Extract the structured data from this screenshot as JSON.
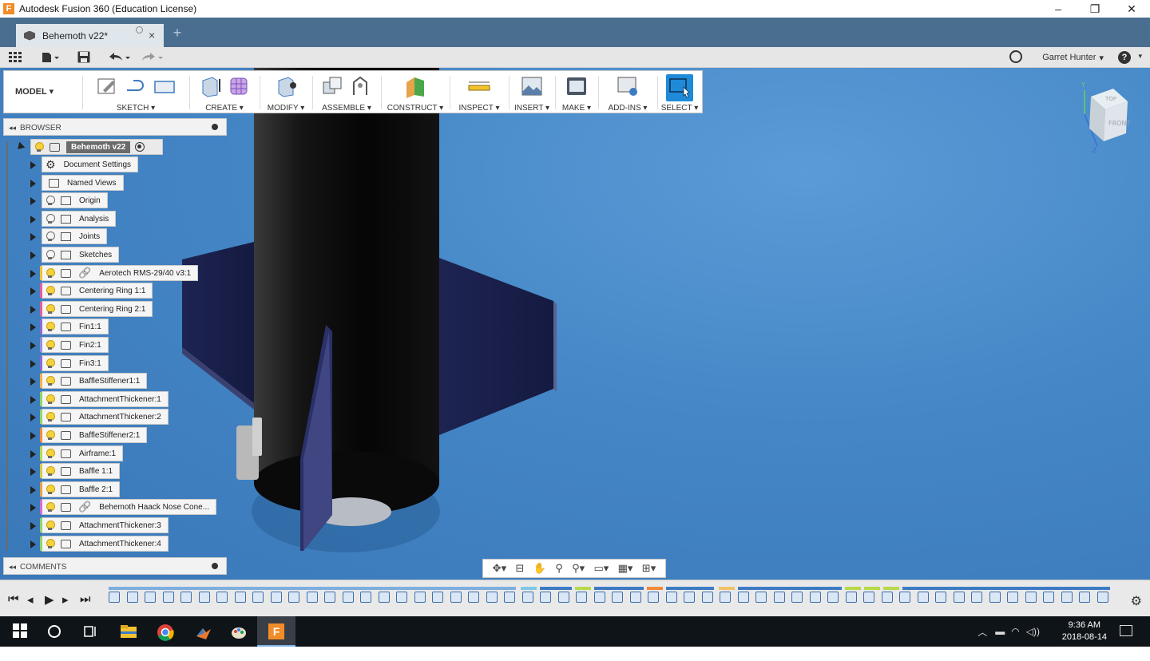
{
  "window": {
    "title": "Autodesk Fusion 360 (Education License)",
    "app_icon_letter": "F",
    "controls": [
      "–",
      "❐",
      "✕"
    ]
  },
  "tabs": {
    "document_tab": "Behemoth v22*",
    "new_tab_glyph": "+"
  },
  "quick_access": {
    "user": "Garret Hunter",
    "user_dropdown": "▾",
    "help_label": "?"
  },
  "toolbar": {
    "workspace": "MODEL ▾",
    "groups": [
      {
        "label": "SKETCH ▾"
      },
      {
        "label": "CREATE ▾"
      },
      {
        "label": "MODIFY ▾"
      },
      {
        "label": "ASSEMBLE ▾"
      },
      {
        "label": "CONSTRUCT ▾"
      },
      {
        "label": "INSPECT ▾"
      },
      {
        "label": "INSERT ▾"
      },
      {
        "label": "MAKE ▾"
      },
      {
        "label": "ADD-INS ▾"
      },
      {
        "label": "SELECT ▾"
      }
    ]
  },
  "browser": {
    "header": "BROWSER",
    "root": "Behemoth v22",
    "items": [
      {
        "label": "Document Settings",
        "icon": "gear-icon",
        "light": false
      },
      {
        "label": "Named Views",
        "icon": "folder-icon",
        "light": false
      },
      {
        "label": "Origin",
        "icon": "folder-icon",
        "light": false
      },
      {
        "label": "Analysis",
        "icon": "folder-icon",
        "light": false
      },
      {
        "label": "Joints",
        "icon": "folder-icon",
        "light": false
      },
      {
        "label": "Sketches",
        "icon": "folder-icon",
        "light": false
      },
      {
        "label": "Aerotech RMS-29/40 v3:1",
        "icon": "component-icon",
        "light": true,
        "linked": true,
        "stripe": "#f2c230"
      },
      {
        "label": "Centering Ring 1:1",
        "icon": "component-icon",
        "light": true,
        "stripe": "#e35d9c"
      },
      {
        "label": "Centering Ring 2:1",
        "icon": "component-icon",
        "light": true,
        "stripe": "#e35d9c"
      },
      {
        "label": "Fin1:1",
        "icon": "component-icon",
        "light": true,
        "stripe": "#8c6ad6"
      },
      {
        "label": "Fin2:1",
        "icon": "component-icon",
        "light": true,
        "stripe": "#9a8bde"
      },
      {
        "label": "Fin3:1",
        "icon": "component-icon",
        "light": true,
        "stripe": "#8c6ad6"
      },
      {
        "label": "BaffleStiffener1:1",
        "icon": "component-icon",
        "light": true,
        "stripe": "#f2b04a"
      },
      {
        "label": "AttachmentThickener:1",
        "icon": "component-icon",
        "light": true,
        "stripe": "#8dd66a"
      },
      {
        "label": "AttachmentThickener:2",
        "icon": "component-icon",
        "light": true,
        "stripe": "#8dd66a"
      },
      {
        "label": "BaffleStiffener2:1",
        "icon": "component-icon",
        "light": true,
        "stripe": "#f28a3a"
      },
      {
        "label": "Airframe:1",
        "icon": "component-icon",
        "light": true,
        "stripe": "#b7d94a"
      },
      {
        "label": "Baffle 1:1",
        "icon": "component-icon",
        "light": true,
        "stripe": "#d4c94a"
      },
      {
        "label": "Baffle 2:1",
        "icon": "component-icon",
        "light": true,
        "stripe": "#e3a14a"
      },
      {
        "label": "Behemoth Haack Nose Cone...",
        "icon": "component-icon",
        "light": true,
        "linked": true,
        "stripe": "#d96ad6"
      },
      {
        "label": "AttachmentThickener:3",
        "icon": "component-icon",
        "light": true,
        "stripe": "#8dd66a"
      },
      {
        "label": "AttachmentThickener:4",
        "icon": "component-icon",
        "light": true,
        "stripe": "#8dd66a"
      }
    ]
  },
  "comments": {
    "header": "COMMENTS"
  },
  "viewcube": {
    "top": "TOP",
    "front": "FRONT",
    "axis_y": "Y",
    "axis_z": "Z"
  },
  "taskbar": {
    "time": "9:36 AM",
    "date": "2018-08-14"
  },
  "colors": {
    "viewport": "#4486c6",
    "tabbar": "#4a6e8f",
    "select_active": "#1f8ad8",
    "taskbar": "#0f1419"
  }
}
